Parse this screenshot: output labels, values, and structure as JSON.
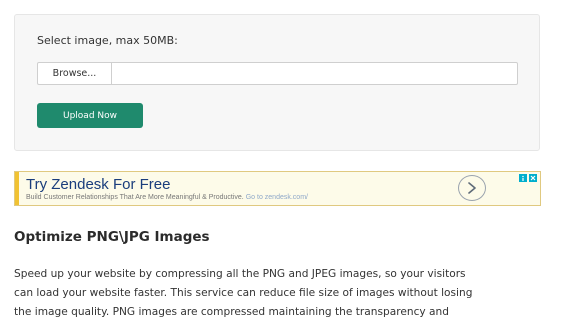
{
  "upload": {
    "label": "Select image, max 50MB:",
    "browse_label": "Browse...",
    "file_value": "",
    "submit_label": "Upload Now"
  },
  "ad": {
    "title": "Try Zendesk For Free",
    "subtitle": "Build Customer Relationships That Are More Meaningful & Productive.",
    "url": "Go to zendesk.com/",
    "icons": [
      "play-arrow-icon",
      "adchoices-icon",
      "close-icon"
    ]
  },
  "content": {
    "heading": "Optimize PNG\\JPG Images",
    "lines": [
      "Speed up your website by compressing all the PNG and JPEG images, so your visitors",
      "can load your website faster. This service can reduce file size of images without losing",
      "the image quality. PNG images are compressed maintaining the transparency and"
    ]
  },
  "colors": {
    "upload_button": "#1f8a6d",
    "ad_title": "#1a3d7c",
    "ad_border": "#e0c980",
    "ad_background": "#fdfbe9"
  }
}
